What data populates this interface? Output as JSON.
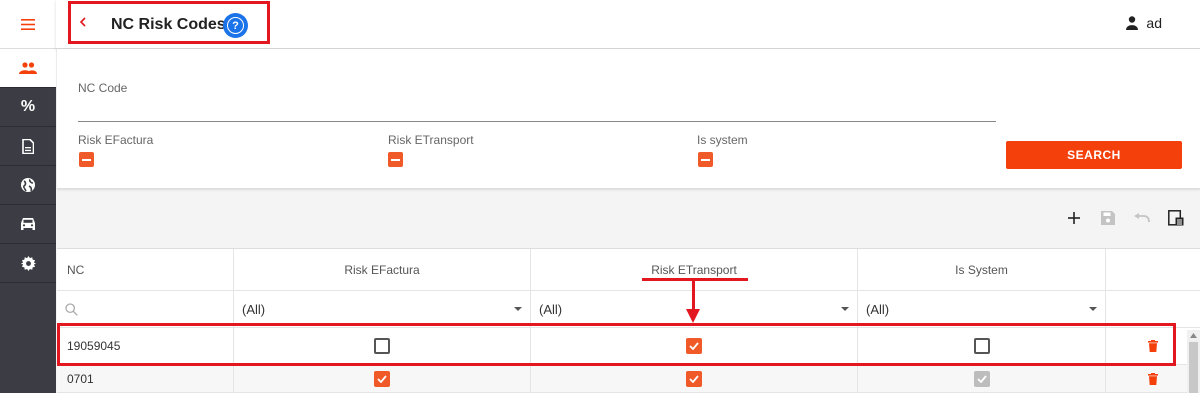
{
  "header": {
    "title": "NC Risk Codes",
    "help_symbol": "?",
    "user_name": "ad"
  },
  "sidebar": {
    "items": [
      {
        "icon": "people-icon"
      },
      {
        "icon": "percent-icon",
        "symbol": "%"
      },
      {
        "icon": "document-icon"
      },
      {
        "icon": "globe-icon"
      },
      {
        "icon": "car-icon"
      },
      {
        "icon": "gear-icon"
      }
    ]
  },
  "filters": {
    "nc_code_label": "NC Code",
    "nc_code_value": "",
    "risk_efactura_label": "Risk EFactura",
    "risk_etransport_label": "Risk ETransport",
    "is_system_label": "Is system",
    "search_label": "SEARCH"
  },
  "grid": {
    "columns": [
      "NC",
      "Risk EFactura",
      "Risk ETransport",
      "Is System"
    ],
    "filter_values": [
      "(All)",
      "(All)",
      "(All)"
    ],
    "rows": [
      {
        "nc": "19059045",
        "risk_efactura": false,
        "risk_etransport": true,
        "is_system": false
      },
      {
        "nc": "0701",
        "risk_efactura": true,
        "risk_etransport": true,
        "is_system": true
      }
    ]
  },
  "colors": {
    "accent": "#f4400b",
    "annotation": "#e3171f",
    "help": "#1a73e8",
    "sidebar": "#3c3d44"
  }
}
